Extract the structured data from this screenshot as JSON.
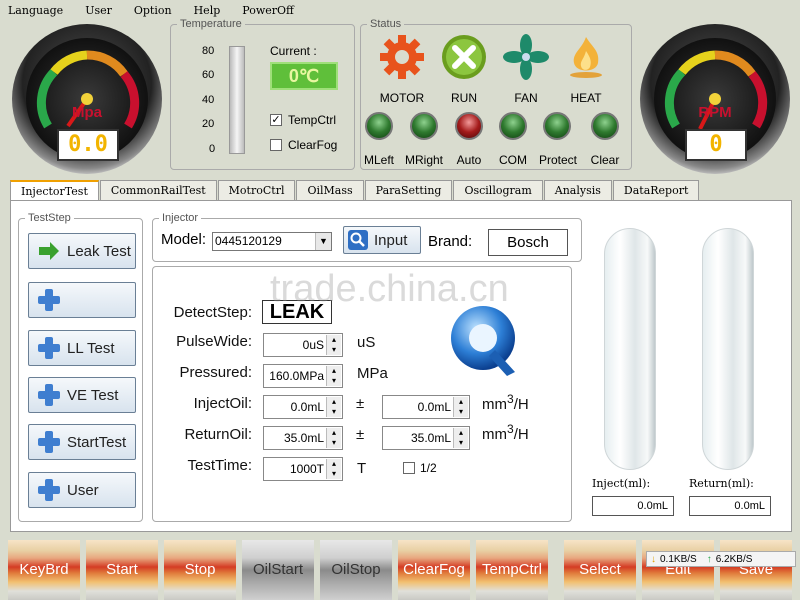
{
  "menu": [
    "Language",
    "User",
    "Option",
    "Help",
    "PowerOff"
  ],
  "gauges": {
    "left": {
      "unit": "Mpa",
      "readout": "0.0"
    },
    "right": {
      "unit": "RPM",
      "readout": "0"
    }
  },
  "temperature": {
    "legend": "Temperature",
    "scale": [
      "80",
      "60",
      "40",
      "20",
      "0"
    ],
    "current_label": "Current :",
    "current_value": "0℃",
    "tempctrl_label": "TempCtrl",
    "tempctrl_checked": true,
    "clearfog_label": "ClearFog",
    "clearfog_checked": false
  },
  "status": {
    "legend": "Status",
    "icons": [
      {
        "label": "MOTOR",
        "icon": "gear-icon"
      },
      {
        "label": "RUN",
        "icon": "close-icon"
      },
      {
        "label": "FAN",
        "icon": "fan-icon"
      },
      {
        "label": "HEAT",
        "icon": "flame-icon"
      }
    ],
    "leds": [
      {
        "label": "MLeft",
        "color": "#2f7a2f"
      },
      {
        "label": "MRight",
        "color": "#2f7a2f"
      },
      {
        "label": "Auto",
        "color": "#a41b1b"
      },
      {
        "label": "COM",
        "color": "#2f7a2f"
      },
      {
        "label": "Protect",
        "color": "#2f7a2f"
      },
      {
        "label": "Clear",
        "color": "#2f7a2f"
      }
    ]
  },
  "tabs": [
    "InjectorTest",
    "CommonRailTest",
    "MotroCtrl",
    "OilMass",
    "ParaSetting",
    "Oscillogram",
    "Analysis",
    "DataReport"
  ],
  "teststep": {
    "legend": "TestStep",
    "buttons": [
      "Leak Test",
      "LL Test",
      "VE Test",
      "StartTest",
      "User"
    ]
  },
  "injector": {
    "legend": "Injector",
    "model_label": "Model:",
    "model_value": "0445120129",
    "input_label": "Input",
    "brand_label": "Brand:",
    "brand_value": "Bosch"
  },
  "detect": {
    "label": "DetectStep:",
    "value": "LEAK"
  },
  "params": {
    "pulsewide": {
      "label": "PulseWide:",
      "value": "0uS",
      "unit": "uS"
    },
    "pressured": {
      "label": "Pressured:",
      "value": "160.0MPa",
      "unit": "MPa"
    },
    "injectoil": {
      "label": "InjectOil:",
      "value": "0.0mL",
      "tol": "0.0mL",
      "pm": "±",
      "unit": "mm",
      "sup": "3",
      "per": "/H"
    },
    "returnoil": {
      "label": "ReturnOil:",
      "value": "35.0mL",
      "tol": "35.0mL",
      "pm": "±",
      "unit": "mm",
      "sup": "3",
      "per": "/H"
    },
    "testtime": {
      "label": "TestTime:",
      "value": "1000T",
      "unit": "T",
      "half_label": "1/2"
    }
  },
  "tubes": {
    "inject_label": "Inject(ml):",
    "inject_value": "0.0mL",
    "return_label": "Return(ml):",
    "return_value": "0.0mL"
  },
  "bottom_buttons": [
    "KeyBrd",
    "Start",
    "Stop",
    "OilStart",
    "OilStop",
    "ClearFog",
    "TempCtrl",
    "Select",
    "Edit",
    "Save"
  ],
  "netspeed": {
    "down": "0.1KB/S",
    "up": "6.2KB/S"
  },
  "watermark": "trade.china.cn"
}
